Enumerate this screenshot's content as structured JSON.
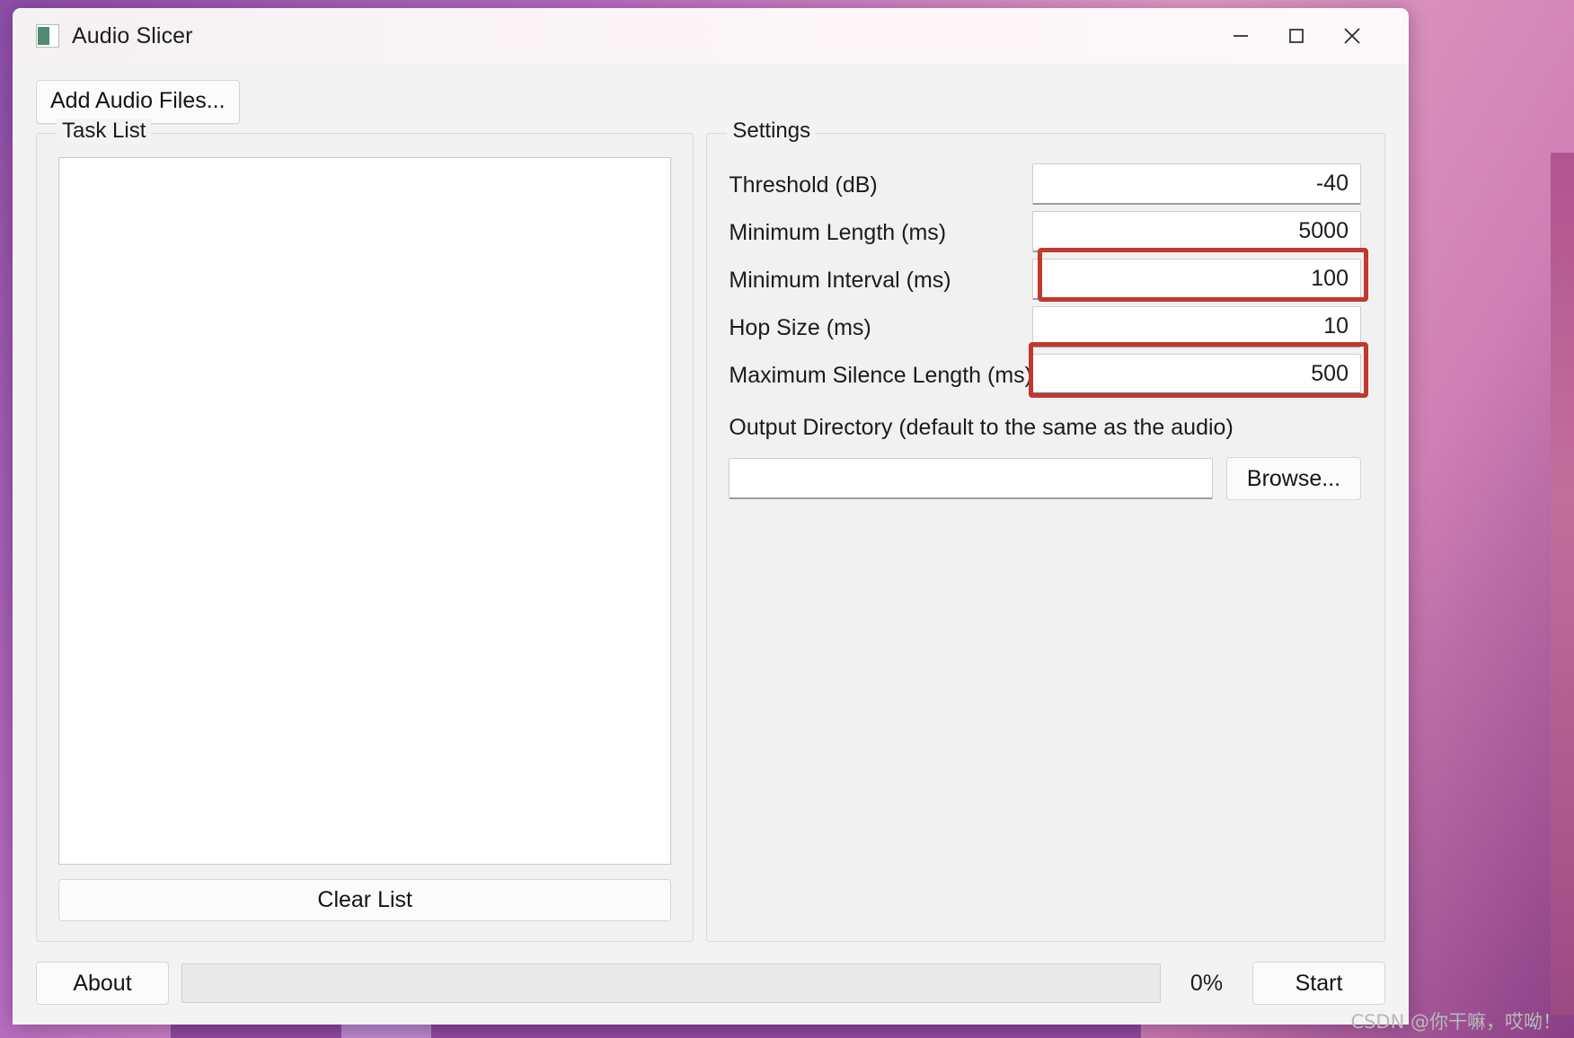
{
  "window": {
    "title": "Audio Slicer",
    "app_icon": "audio-slicer-icon",
    "controls": {
      "minimize": "minimize-icon",
      "maximize": "maximize-icon",
      "close": "close-icon"
    }
  },
  "toolbar": {
    "add_audio_files_label": "Add Audio Files..."
  },
  "task_panel": {
    "group_title": "Task List",
    "items": [],
    "clear_list_label": "Clear List"
  },
  "settings_panel": {
    "group_title": "Settings",
    "rows": [
      {
        "label": "Threshold (dB)",
        "value": "-40",
        "highlighted": false,
        "focused": false
      },
      {
        "label": "Minimum Length (ms)",
        "value": "5000",
        "highlighted": false,
        "focused": false
      },
      {
        "label": "Minimum Interval (ms)",
        "value": "100",
        "highlighted": true,
        "focused": false
      },
      {
        "label": "Hop Size (ms)",
        "value": "10",
        "highlighted": false,
        "focused": false
      },
      {
        "label": "Maximum Silence Length (ms)",
        "value": "500",
        "highlighted": true,
        "focused": true
      }
    ],
    "output_directory_label": "Output Directory (default to the same as the audio)",
    "output_directory_value": "",
    "output_directory_placeholder": "",
    "browse_label": "Browse..."
  },
  "status_bar": {
    "about_label": "About",
    "progress_percent_label": "0%",
    "progress_value": 0,
    "start_label": "Start"
  },
  "watermark": {
    "text": "CSDN @你干嘛，哎呦！"
  },
  "colors": {
    "window_background": "#f3f3f3",
    "pane_background": "#f1f1f1",
    "annotation_red": "#c0392b",
    "focus_blue": "#4a7ea8",
    "text_primary": "#1b1b1b",
    "desktop_purple": "#8d4ea8"
  }
}
